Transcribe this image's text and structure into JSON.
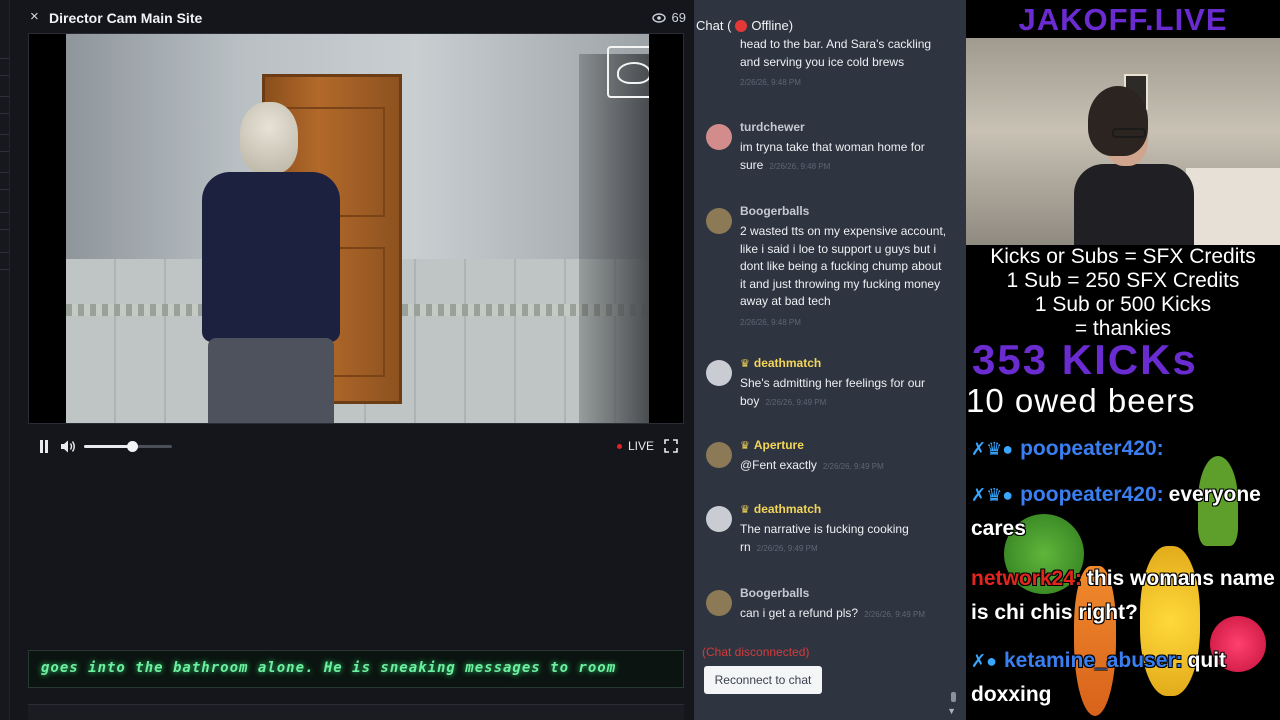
{
  "player": {
    "title": "Director Cam Main Site",
    "viewer_count": "69",
    "close_glyph": "×",
    "live_label": "LIVE",
    "volume_level": 0.55,
    "ticker_text": "goes into the bathroom alone. He is sneaking messages to room"
  },
  "chat": {
    "title_prefix": "Chat (",
    "title_status": "Offline)",
    "messages": [
      {
        "name": "",
        "badge": "",
        "text": "head to the bar. And Sara's cackling and serving you ice cold brews",
        "time": "2/26/26, 9:48 PM",
        "avatar": "#6b6f7c"
      },
      {
        "name": "turdchewer",
        "badge": "",
        "text": "im tryna take that woman home for sure",
        "time": "2/26/26, 9:48 PM",
        "avatar": "#d28c8c"
      },
      {
        "name": "Boogerballs",
        "badge": "",
        "text": "2 wasted tts on my expensive account, like i said i loe to support u guys but i dont like being a fucking chump about it and just throwing my fucking money away at bad tech",
        "time": "2/26/26, 9:48 PM",
        "avatar": "#8b7a55"
      },
      {
        "name": "deathmatch",
        "badge": "crown",
        "text": "She's admitting her feelings for our boy",
        "time": "2/26/26, 9:49 PM",
        "avatar": "#c9ccd3"
      },
      {
        "name": "Aperture",
        "badge": "crown",
        "text": "@Fent exactly",
        "time": "2/26/26, 9:49 PM",
        "avatar": "#8b7a55"
      },
      {
        "name": "deathmatch",
        "badge": "crown",
        "text": "The narrative is fucking cooking rn",
        "time": "2/26/26, 9:49 PM",
        "avatar": "#c9ccd3"
      },
      {
        "name": "Boogerballs",
        "badge": "",
        "text": "can i get a refund pls?",
        "time": "2/26/26, 9:49 PM",
        "avatar": "#8b7a55"
      }
    ],
    "disconnected_text": "(Chat disconnected)",
    "reconnect_label": "Reconnect to chat"
  },
  "stream": {
    "title": "JAKOFF.LIVE",
    "info_lines": [
      "Kicks or Subs = SFX Credits",
      "1 Sub = 250 SFX Credits",
      "1 Sub or 500 Kicks",
      "= thankies"
    ],
    "kicks": "353 KICKs",
    "owed": "10 owed beers",
    "overlay_chat": [
      {
        "user": "poopeater420:",
        "msg": "",
        "user_color": "blue",
        "badges": "sword-crown-orb"
      },
      {
        "user": "poopeater420:",
        "msg": "everyone cares",
        "user_color": "blue",
        "badges": "sword-crown-orb"
      },
      {
        "user": "network24:",
        "msg": "this womans name is chi chis right?",
        "user_color": "red",
        "badges": ""
      },
      {
        "user": "ketamine_abuser:",
        "msg": "quit doxxing",
        "user_color": "blue",
        "badges": "sword-red-orb"
      }
    ]
  },
  "colors": {
    "chat_bg": "#2e3440",
    "crown_gold": "#f3d65a",
    "stream_purple": "#6a2bd0",
    "ticker_green": "#6ff0a0",
    "offline_red": "#e53838"
  }
}
